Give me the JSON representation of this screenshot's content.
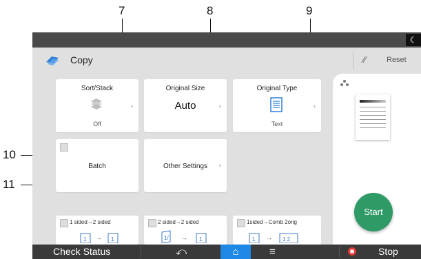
{
  "callouts": [
    "7",
    "8",
    "9",
    "10",
    "11"
  ],
  "app": {
    "title": "Copy"
  },
  "header": {
    "reset_label": "Reset"
  },
  "tiles": {
    "sort_stack": {
      "title": "Sort/Stack",
      "value": "Off"
    },
    "original_size": {
      "title": "Original Size",
      "value": "Auto"
    },
    "original_type": {
      "title": "Original Type",
      "value": "Text"
    },
    "batch": {
      "title": "Batch"
    },
    "other_settings": {
      "title": "Other Settings"
    }
  },
  "shortcuts": [
    {
      "label": "1 sided→2 sided"
    },
    {
      "label": "2 sided→2 sided"
    },
    {
      "label": "1sided→Comb 2orig"
    }
  ],
  "start_button": {
    "label": "Start"
  },
  "bottom_bar": {
    "check_status": "Check Status",
    "stop": "Stop"
  },
  "colors": {
    "start_green": "#2e9a66",
    "home_blue": "#1e88e5",
    "stop_red": "#e53935"
  },
  "icons": [
    "copy-icon",
    "reset-icon",
    "stack-icon",
    "document-icon",
    "back-icon",
    "home-icon",
    "menu-icon",
    "stop-icon"
  ]
}
